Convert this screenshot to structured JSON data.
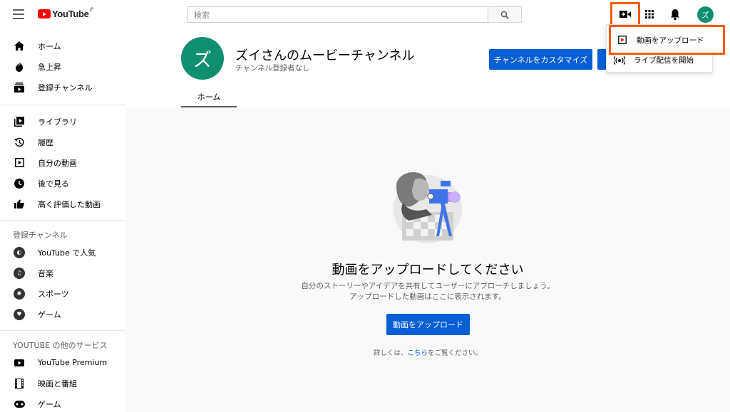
{
  "header": {
    "logo_text": "YouTube",
    "logo_region": "JP",
    "search_placeholder": "検索",
    "avatar_letter": "ズ"
  },
  "sidebar": {
    "main": [
      {
        "label": "ホーム",
        "icon": "home-icon"
      },
      {
        "label": "急上昇",
        "icon": "trending-icon"
      },
      {
        "label": "登録チャンネル",
        "icon": "subscriptions-icon"
      }
    ],
    "library": [
      {
        "label": "ライブラリ",
        "icon": "library-icon"
      },
      {
        "label": "履歴",
        "icon": "history-icon"
      },
      {
        "label": "自分の動画",
        "icon": "my-videos-icon"
      },
      {
        "label": "後で見る",
        "icon": "watch-later-icon"
      },
      {
        "label": "高く評価した動画",
        "icon": "liked-icon"
      }
    ],
    "subs_heading": "登録チャンネル",
    "subs": [
      {
        "label": "YouTube で人気",
        "icon": "popular-icon"
      },
      {
        "label": "音楽",
        "icon": "music-icon"
      },
      {
        "label": "スポーツ",
        "icon": "sports-icon"
      },
      {
        "label": "ゲーム",
        "icon": "gaming-icon"
      }
    ],
    "more_heading": "YOUTUBE の他のサービス",
    "more": [
      {
        "label": "YouTube Premium",
        "icon": "premium-icon"
      },
      {
        "label": "映画と番組",
        "icon": "movies-icon"
      },
      {
        "label": "ゲーム",
        "icon": "gaming-icon"
      }
    ]
  },
  "channel": {
    "avatar_letter": "ズ",
    "name": "ズイさんのムービーチャンネル",
    "subscribers": "チャンネル登録者なし",
    "customize_label": "チャンネルをカスタマイズ",
    "tab_home": "ホーム"
  },
  "empty_state": {
    "title": "動画をアップロードしてください",
    "desc_line1": "自分のストーリーやアイデアを共有してユーザーにアプローチしましょう。",
    "desc_line2": "アップロードした動画はここに表示されます。",
    "upload_label": "動画をアップロード",
    "learn_prefix": "詳しくは、",
    "learn_link": "こちら",
    "learn_suffix": "をご覧ください。"
  },
  "dropdown": {
    "upload_label": "動画をアップロード",
    "live_label": "ライブ配信を開始"
  },
  "colors": {
    "accent": "#065fd4",
    "avatar": "#0f8f6f",
    "highlight": "#f25b0c",
    "logo_red": "#ff0000"
  }
}
